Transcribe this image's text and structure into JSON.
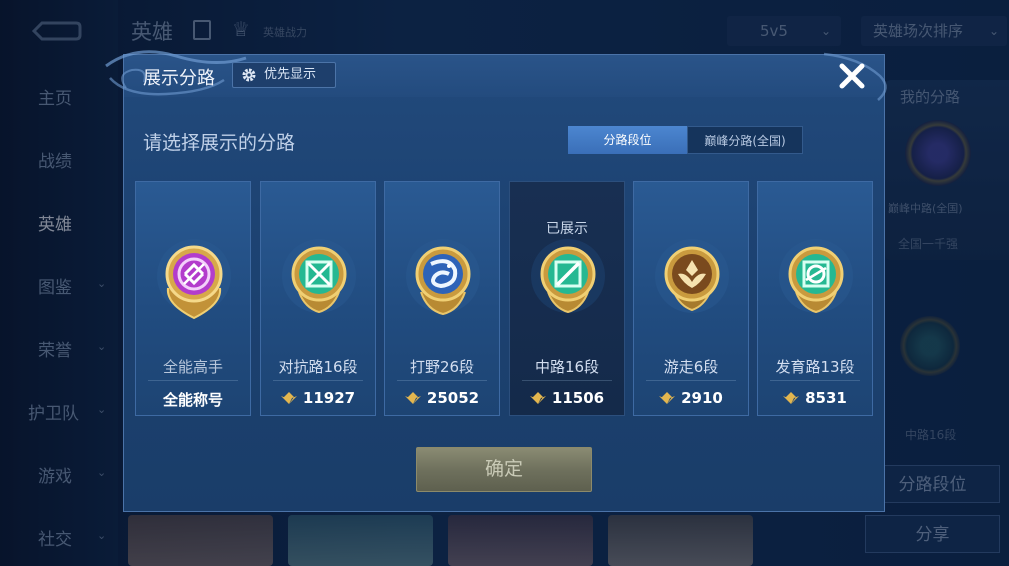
{
  "background": {
    "sidebar_items": [
      {
        "label": "主页",
        "has_chevron": false
      },
      {
        "label": "战绩",
        "has_chevron": false
      },
      {
        "label": "英雄",
        "has_chevron": false,
        "active": true
      },
      {
        "label": "图鉴",
        "has_chevron": true
      },
      {
        "label": "荣誉",
        "has_chevron": true
      },
      {
        "label": "护卫队",
        "has_chevron": true
      },
      {
        "label": "游戏",
        "has_chevron": true
      },
      {
        "label": "社交",
        "has_chevron": true
      }
    ],
    "page_title": "英雄",
    "power_label": "英雄战力",
    "mode_select": "5v5",
    "sort_select": "英雄场次排序",
    "my_lane_title": "我的分路",
    "peak_lane": "巅峰中路(全国)",
    "national_rank": "全国一千强",
    "lane_rank": "中路16段",
    "lane_rank_button": "分路段位",
    "share_button": "分享"
  },
  "modal": {
    "title": "展示分路",
    "priority_button": "优先显示",
    "subtitle": "请选择展示的分路",
    "tabs": [
      "分路段位",
      "巅峰分路(全国)"
    ],
    "active_tab": 0,
    "shown_label": "已展示",
    "lanes": [
      {
        "name": "全能高手",
        "score": "全能称号",
        "emblem": "allround-emblem-icon",
        "selected": false
      },
      {
        "name": "对抗路16段",
        "score": "11927",
        "emblem": "clash-lane-emblem-icon",
        "selected": false
      },
      {
        "name": "打野26段",
        "score": "25052",
        "emblem": "jungle-emblem-icon",
        "selected": false
      },
      {
        "name": "中路16段",
        "score": "11506",
        "emblem": "mid-lane-emblem-icon",
        "selected": true
      },
      {
        "name": "游走6段",
        "score": "2910",
        "emblem": "roam-emblem-icon",
        "selected": false
      },
      {
        "name": "发育路13段",
        "score": "8531",
        "emblem": "farm-lane-emblem-icon",
        "selected": false
      }
    ],
    "confirm_button": "确定"
  },
  "colors": {
    "accent_tab": "#3a6fb8",
    "gold": "#d8a53a",
    "teal": "#2fbf9a",
    "purple": "#b23fcc"
  }
}
